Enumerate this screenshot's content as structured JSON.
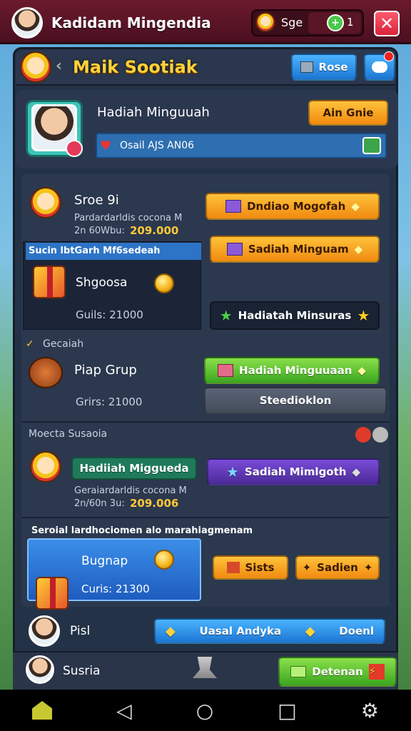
{
  "header": {
    "app_title": "Kadidam Mingendia",
    "currency_label": "Sge",
    "gems_label": "1",
    "close_glyph": "✕"
  },
  "panel": {
    "title": "Maik Sootiak",
    "rose_button": "Rose",
    "profile_name": "Hadiah Minguuah",
    "action_button": "Ain Gnie",
    "info_bar": "Osail AJS AN06",
    "row1": {
      "title": "Sroe 9i",
      "sub": "Pardardarldis cocona M",
      "amount_prefix": "2n 60Wbu:",
      "amount": "209.000",
      "btn": "Dndiao Mogofah"
    },
    "featured1": {
      "label": "Sucin lbtGarh Mf6sedeah",
      "name": "Shgoosa",
      "price": "Guils: 21000"
    },
    "btn_sadiah": "Sadiah Minguam",
    "btn_hadiah_minsuras": "Hadiatah Minsuras",
    "section_secciah": "Gecaiah",
    "row2": {
      "title": "Piap Grup",
      "price": "Grirs: 21000",
      "btn": "Hadiah Minguuaan",
      "btn2": "Steedioklon"
    },
    "section_moecta": "Moecta Susaoia",
    "row3": {
      "pill": "Hadiiah Miggueda",
      "sub": "Geraiardarldis cocona M",
      "amount_prefix": "2n/60n 3u:",
      "amount": "209.006",
      "btn": "Sadiah Mimlgoth"
    },
    "featured2": {
      "label": "Seroial lardhociomen alo marahiagmenam",
      "name": "Bugnap",
      "price": "Curis: 21300",
      "btn_sists": "Sists",
      "btn_sadien": "Sadien"
    },
    "footer_row": {
      "name": "Pisl",
      "btn1": "Uasal Andyka",
      "btn2": "Doenl"
    }
  },
  "bottom": {
    "name": "Susria",
    "btn": "Detenan"
  },
  "navbar": {
    "home": "home-icon",
    "back": "◁",
    "circle": "○",
    "square": "□",
    "settings": "⚙"
  }
}
